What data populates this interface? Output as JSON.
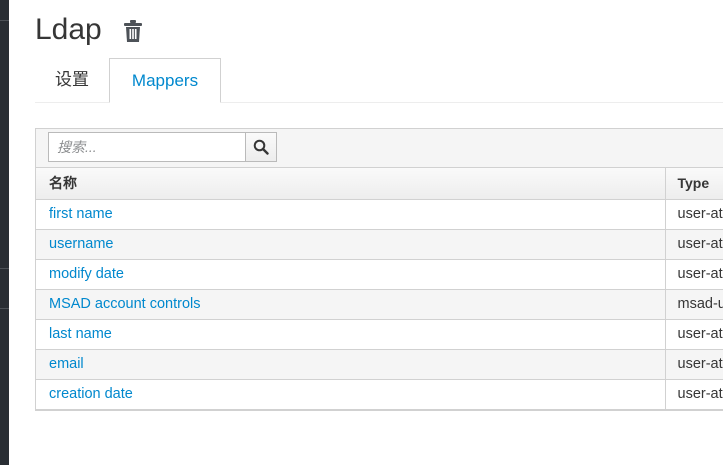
{
  "page": {
    "title": "Ldap"
  },
  "tabs": [
    {
      "label": "设置",
      "active": false
    },
    {
      "label": "Mappers",
      "active": true
    }
  ],
  "search": {
    "placeholder": "搜索...",
    "value": ""
  },
  "table": {
    "columns": [
      "名称",
      "Type"
    ],
    "rows": [
      {
        "name": "first name",
        "type": "user-at"
      },
      {
        "name": "username",
        "type": "user-at"
      },
      {
        "name": "modify date",
        "type": "user-at"
      },
      {
        "name": "MSAD account controls",
        "type": "msad-u"
      },
      {
        "name": "last name",
        "type": "user-at"
      },
      {
        "name": "email",
        "type": "user-at"
      },
      {
        "name": "creation date",
        "type": "user-at"
      }
    ]
  },
  "colors": {
    "link": "#0088ce",
    "sidebar": "#292e34",
    "border": "#d1d1d1"
  },
  "icons": {
    "delete": "trash-icon",
    "search": "search-icon"
  }
}
